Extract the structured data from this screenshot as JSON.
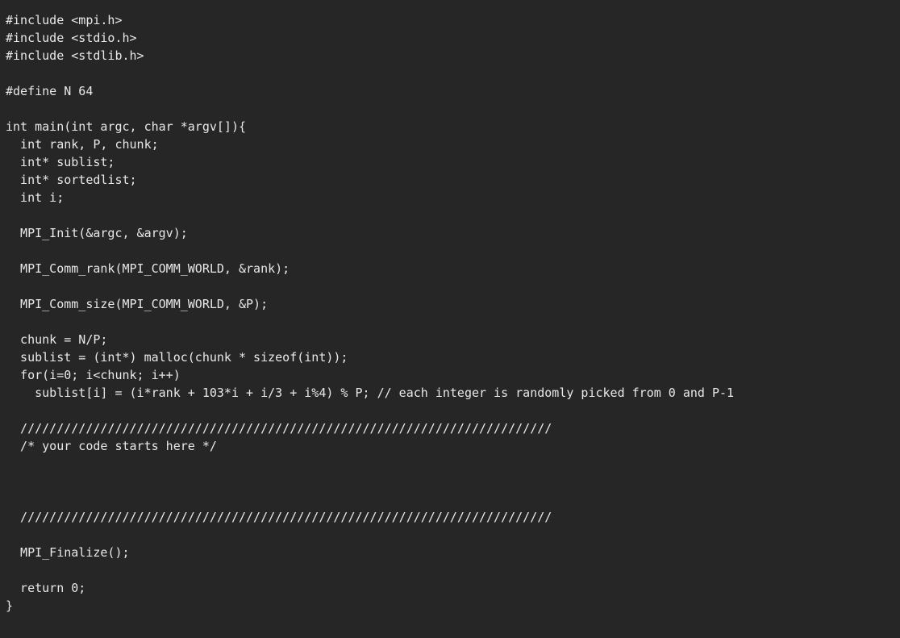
{
  "window": {
    "kind": "code-editor-view",
    "background_color": "#262626",
    "foreground_color": "#e8e8e8"
  },
  "editor": {
    "language": "C",
    "font_size_px": 15,
    "line_height_px": 22,
    "lines": [
      "#include <mpi.h>",
      "#include <stdio.h>",
      "#include <stdlib.h>",
      "",
      "#define N 64",
      "",
      "int main(int argc, char *argv[]){",
      "  int rank, P, chunk;",
      "  int* sublist;",
      "  int* sortedlist;",
      "  int i;",
      "",
      "  MPI_Init(&argc, &argv);",
      "",
      "  MPI_Comm_rank(MPI_COMM_WORLD, &rank);",
      "",
      "  MPI_Comm_size(MPI_COMM_WORLD, &P);",
      "",
      "  chunk = N/P;",
      "  sublist = (int*) malloc(chunk * sizeof(int));",
      "  for(i=0; i<chunk; i++)",
      "    sublist[i] = (i*rank + 103*i + i/3 + i%4) % P; // each integer is randomly picked from 0 and P-1",
      "",
      "  /////////////////////////////////////////////////////////////////////////",
      "  /* your code starts here */",
      "",
      "",
      "",
      "  /////////////////////////////////////////////////////////////////////////",
      "",
      "  MPI_Finalize();",
      "",
      "  return 0;",
      "}"
    ]
  }
}
